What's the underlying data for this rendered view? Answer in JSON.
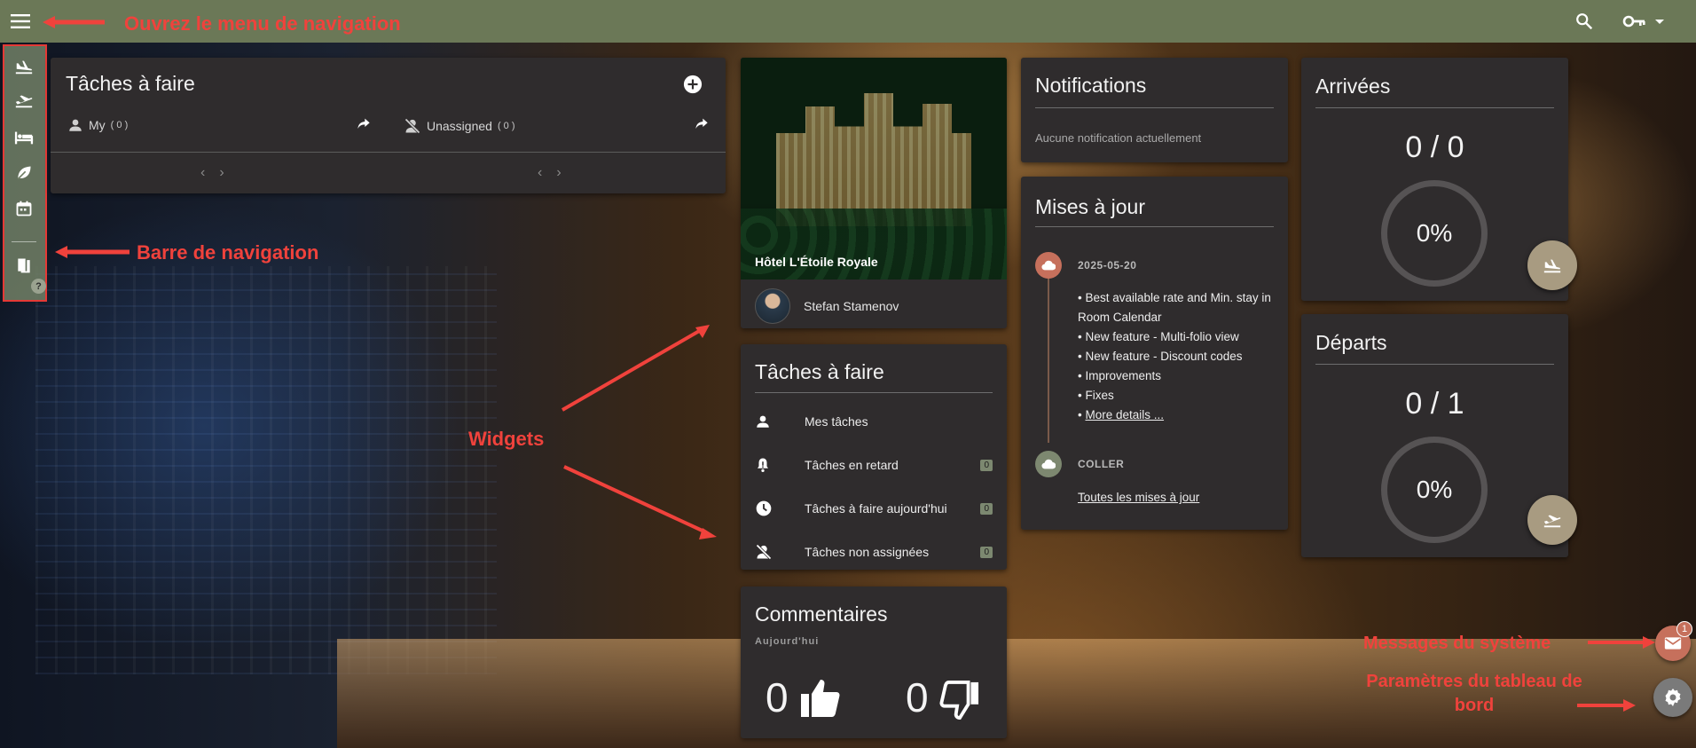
{
  "topbar": {
    "menu_icon": "menu-icon",
    "search_icon": "search-icon",
    "key_icon": "key-icon",
    "dropdown_icon": "caret-down-icon",
    "color": "#6b7857"
  },
  "sidenav": {
    "items": [
      {
        "icon": "flight-land-icon"
      },
      {
        "icon": "flight-takeoff-icon"
      },
      {
        "icon": "bed-icon"
      },
      {
        "icon": "leaf-icon"
      },
      {
        "icon": "calendar-icon"
      },
      {
        "icon": "book-icon"
      }
    ],
    "help_label": "?"
  },
  "tasks_main": {
    "title": "Tâches à faire",
    "my_label": "My",
    "my_count": "( 0 )",
    "unassigned_label": "Unassigned",
    "unassigned_count": "( 0 )"
  },
  "hotel": {
    "name": "Hôtel L'Étoile Royale",
    "user_name": "Stefan Stamenov"
  },
  "tasks_widget": {
    "title": "Tâches à faire",
    "items": [
      {
        "label": "Mes tâches",
        "icon": "person-icon",
        "badge": ""
      },
      {
        "label": "Tâches en retard",
        "icon": "alarm-bell-icon",
        "badge": "0"
      },
      {
        "label": "Tâches à faire aujourd'hui",
        "icon": "clock-icon",
        "badge": "0"
      },
      {
        "label": "Tâches non assignées",
        "icon": "person-off-icon",
        "badge": "0"
      }
    ]
  },
  "comments": {
    "title": "Commentaires",
    "subtitle": "Aujourd'hui",
    "likes": "0",
    "dislikes": "0"
  },
  "notifications": {
    "title": "Notifications",
    "empty_text": "Aucune notification actuellement"
  },
  "updates": {
    "title": "Mises à jour",
    "date": "2025-05-20",
    "items": [
      "• Best available rate and Min. stay in Room Calendar",
      "• New feature - Multi-folio view",
      "• New feature - Discount codes",
      "• Improvements",
      "• Fixes"
    ],
    "more_prefix": "• ",
    "more_link": "More details ...",
    "coller_label": "COLLER",
    "all_updates": "Toutes les mises à jour"
  },
  "arrivals": {
    "title": "Arrivées",
    "ratio": "0 / 0",
    "percent_label": "0%",
    "percent_value": 0
  },
  "departures": {
    "title": "Départs",
    "ratio": "0 / 1",
    "percent_label": "0%",
    "percent_value": 0
  },
  "system": {
    "messages_badge": "1",
    "accent": "#c6705c"
  },
  "annotations": {
    "menu": "Ouvrez le menu de navigation",
    "navbar": "Barre de navigation",
    "widgets": "Widgets",
    "messages": "Messages du système",
    "settings_line1": "Paramètres du tableau de",
    "settings_line2": "bord"
  }
}
